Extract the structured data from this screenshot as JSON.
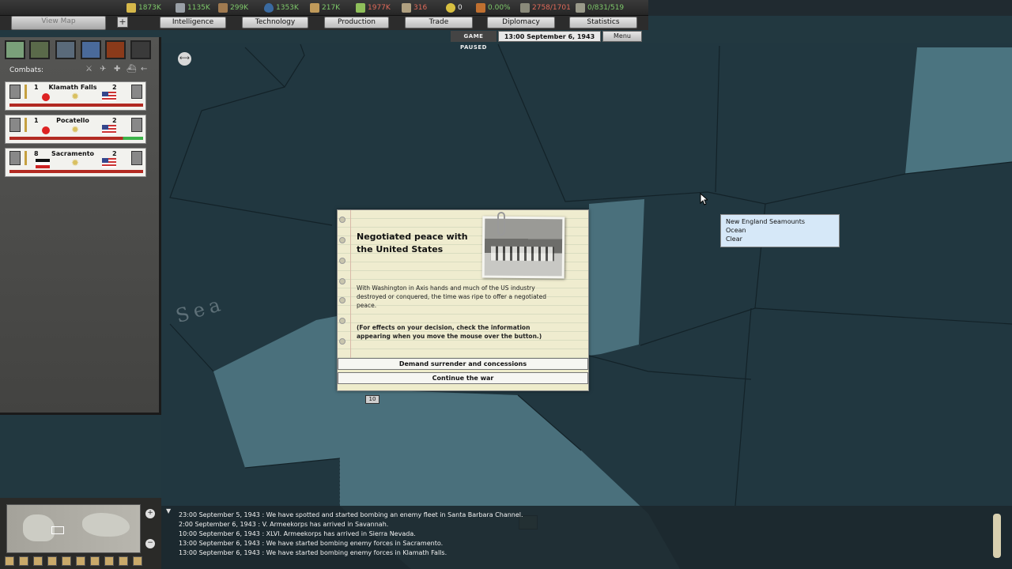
{
  "resources": [
    {
      "icon": "energy-icon",
      "value": "1873K",
      "color": "#7ec96a"
    },
    {
      "icon": "metal-icon",
      "value": "1135K",
      "color": "#7ec96a"
    },
    {
      "icon": "rare-materials-icon",
      "value": "299K",
      "color": "#7ec96a"
    },
    {
      "icon": "oil-icon",
      "value": "1353K",
      "color": "#7ec96a"
    },
    {
      "icon": "supplies-icon",
      "value": "217K",
      "color": "#7ec96a"
    },
    {
      "icon": "money-icon",
      "value": "1977K",
      "color": "#e06a5a"
    },
    {
      "icon": "manpower-icon",
      "value": "316",
      "color": "#e06a5a"
    },
    {
      "icon": "nuclear-icon",
      "value": "0",
      "color": "#e8e8e8"
    },
    {
      "icon": "dissent-icon",
      "value": "0.00%",
      "color": "#7ec96a"
    },
    {
      "icon": "transport-icon",
      "value": "2758/1701",
      "color": "#e06a5a"
    },
    {
      "icon": "officers-icon",
      "value": "0/831/519",
      "color": "#7ec96a"
    }
  ],
  "tabs": {
    "view_map": "View Map",
    "intelligence": "Intelligence",
    "technology": "Technology",
    "production": "Production",
    "trade": "Trade",
    "diplomacy": "Diplomacy",
    "statistics": "Statistics"
  },
  "status": {
    "paused": "GAME PAUSED",
    "datetime": "13:00 September 6, 1943",
    "menu": "Menu"
  },
  "left_panel": {
    "combats_label": "Combats:",
    "combats": [
      {
        "attacker_count": "1",
        "city": "Klamath Falls",
        "defender_count": "2",
        "attacker_flag": "japan",
        "defender_flag": "usa",
        "bar": "red"
      },
      {
        "attacker_count": "1",
        "city": "Pocatello",
        "defender_count": "2",
        "attacker_flag": "japan",
        "defender_flag": "usa",
        "bar": "red-green"
      },
      {
        "attacker_count": "8",
        "city": "Sacramento",
        "defender_count": "2",
        "attacker_flag": "germany",
        "defender_flag": "usa",
        "bar": "red"
      }
    ]
  },
  "map": {
    "sea_label": "Sea",
    "unit_counter": "10"
  },
  "tooltip": {
    "province": "New England Seamounts",
    "terrain": "Ocean",
    "weather": "Clear"
  },
  "event": {
    "title": "Negotiated peace with the United States",
    "body": "With Washington in Axis hands and much of the US industry destroyed or conquered, the time was ripe to offer a negotiated peace.",
    "note": "(For effects on your decision, check the information appearing when you move the mouse over the button.)",
    "option_a": "Demand surrender and concessions",
    "option_b": "Continue the war"
  },
  "log": [
    "23:00 September 5, 1943 : We have spotted and started bombing an enemy fleet in Santa Barbara Channel.",
    "2:00 September 6, 1943 : V. Armeekorps has arrived in Savannah.",
    "10:00 September 6, 1943 : XLVI. Armeekorps has arrived in Sierra Nevada.",
    "13:00 September 6, 1943 : We have started bombing enemy forces in Sacramento.",
    "13:00 September 6, 1943 : We have started bombing enemy forces in Klamath Falls."
  ]
}
